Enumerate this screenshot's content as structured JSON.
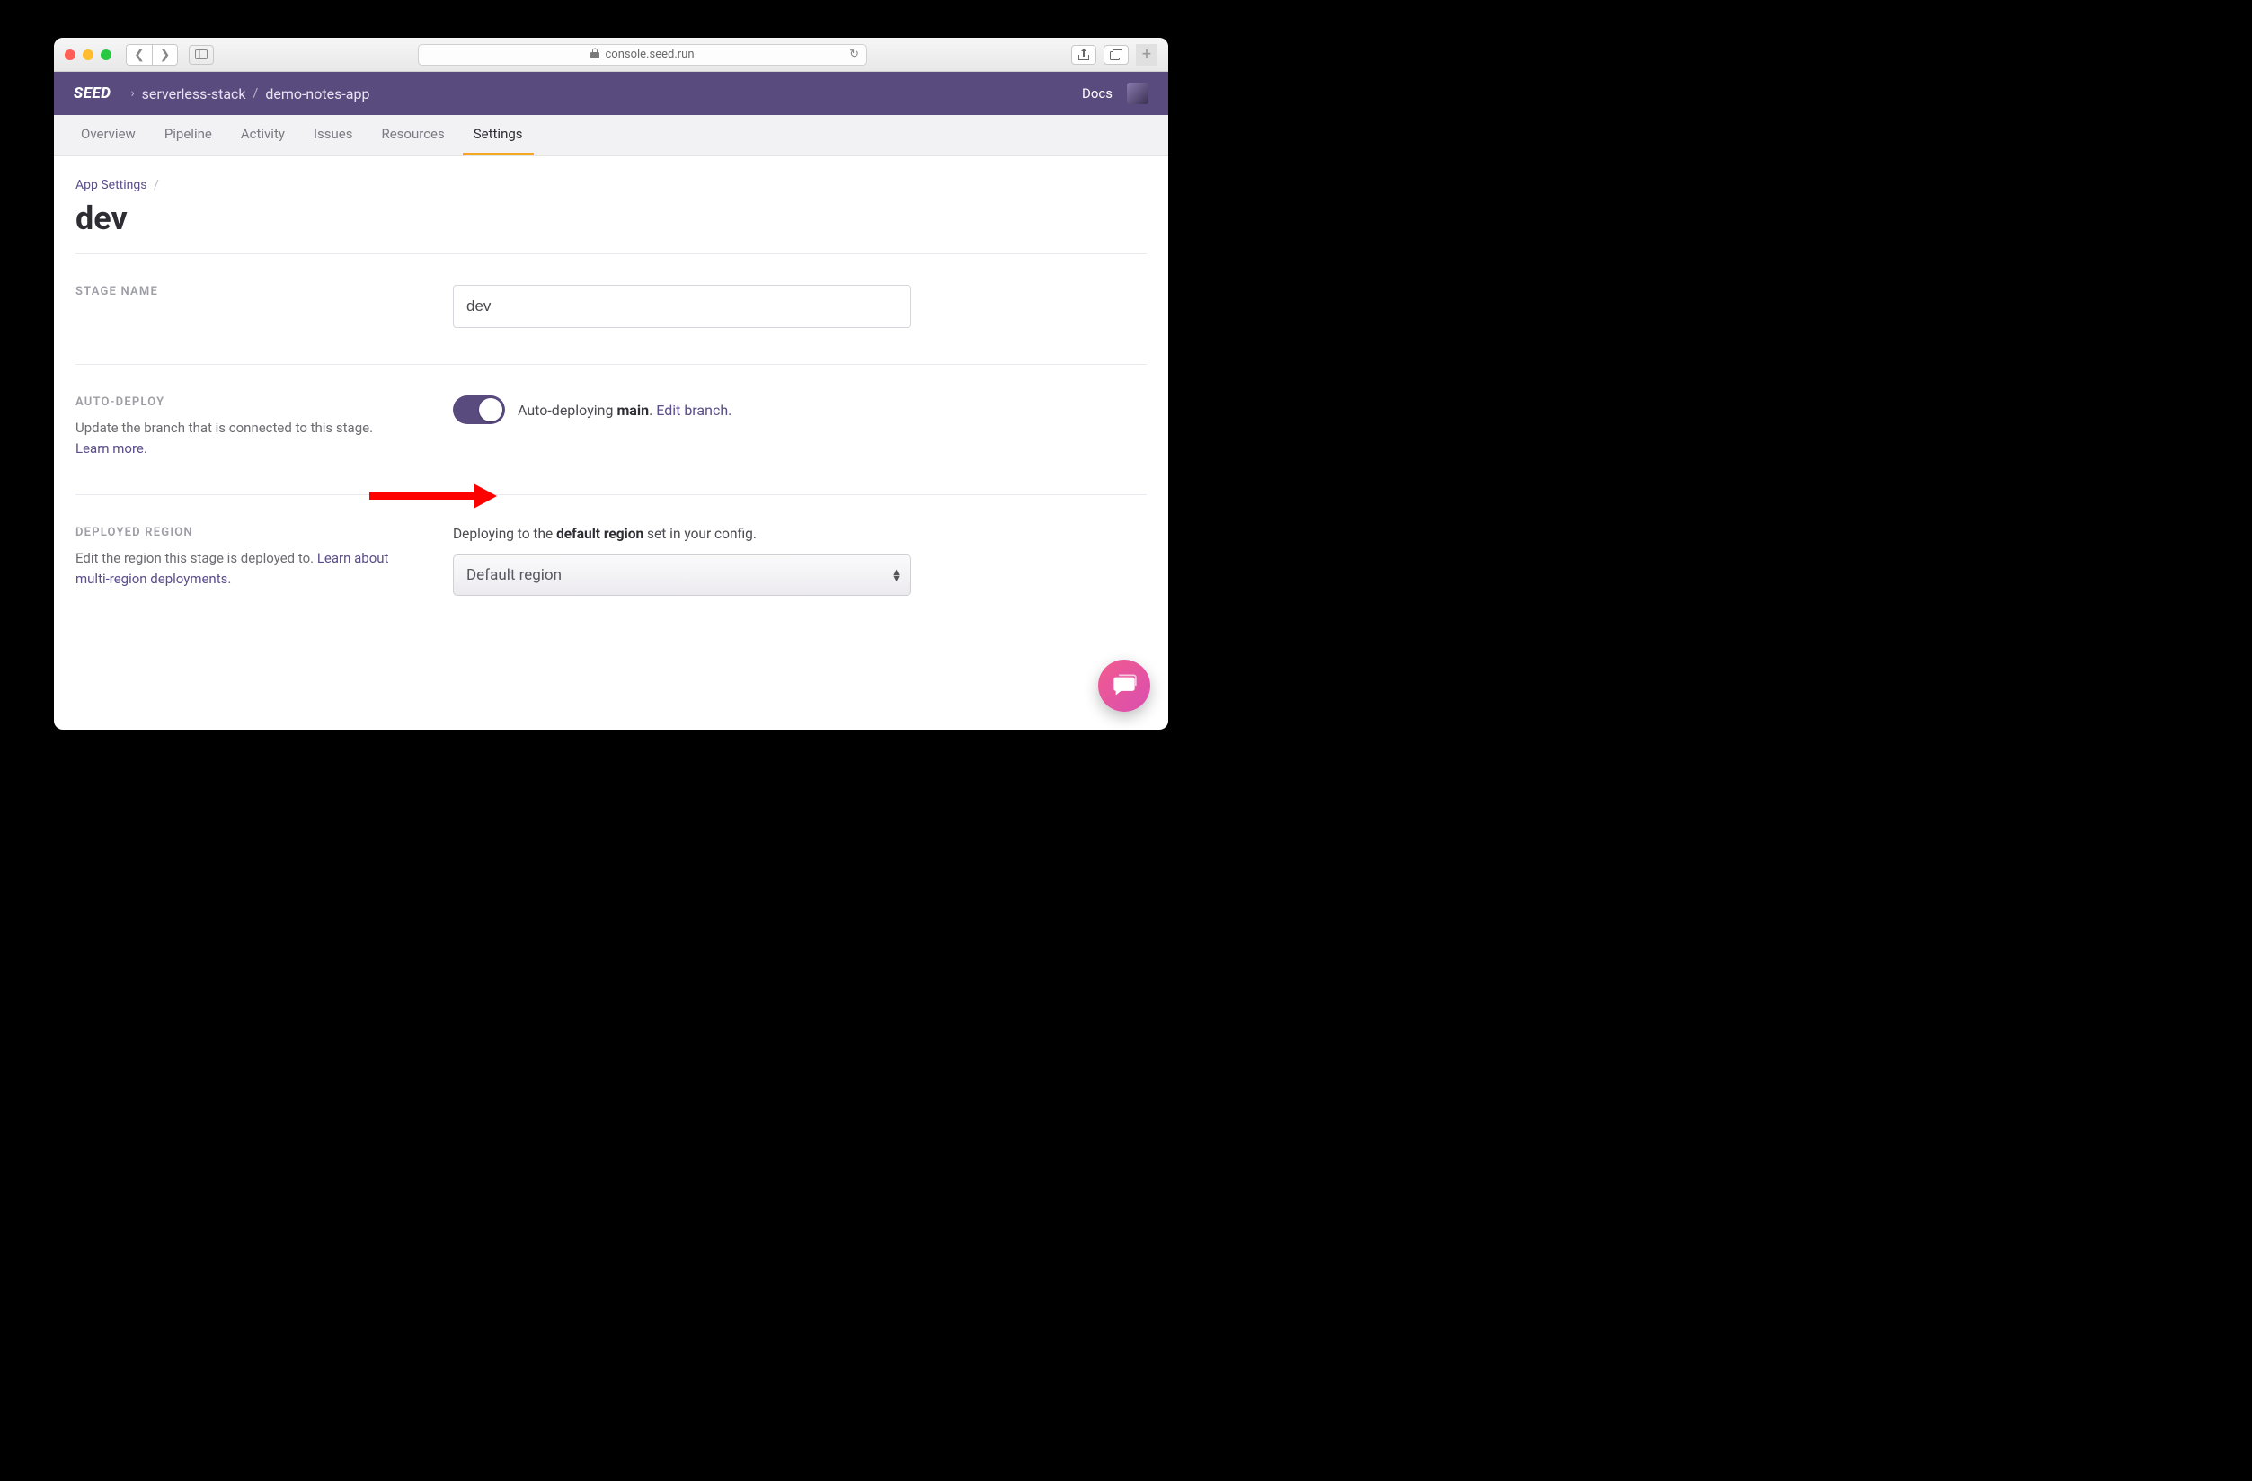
{
  "browser": {
    "url": "console.seed.run"
  },
  "header": {
    "logo": "SEED",
    "breadcrumb": [
      "serverless-stack",
      "demo-notes-app"
    ],
    "docs": "Docs"
  },
  "tabs": [
    {
      "label": "Overview",
      "active": false
    },
    {
      "label": "Pipeline",
      "active": false
    },
    {
      "label": "Activity",
      "active": false
    },
    {
      "label": "Issues",
      "active": false
    },
    {
      "label": "Resources",
      "active": false
    },
    {
      "label": "Settings",
      "active": true
    }
  ],
  "breadcrumb": {
    "parent": "App Settings"
  },
  "page_title": "dev",
  "stage_name": {
    "label": "STAGE NAME",
    "value": "dev"
  },
  "auto_deploy": {
    "label": "AUTO-DEPLOY",
    "desc_prefix": "Update the branch that is connected to this stage. ",
    "learn_more": "Learn more.",
    "status_prefix": "Auto-deploying ",
    "branch": "main",
    "status_suffix": ". ",
    "edit_link": "Edit branch.",
    "enabled": true
  },
  "deployed_region": {
    "label": "DEPLOYED REGION",
    "desc_prefix": "Edit the region this stage is deployed to. ",
    "learn_link": "Learn about multi-region deployments.",
    "text_prefix": "Deploying to the ",
    "text_bold": "default region",
    "text_suffix": " set in your config.",
    "select_value": "Default region"
  }
}
